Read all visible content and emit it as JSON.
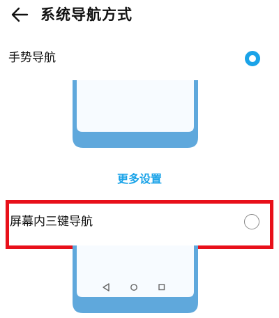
{
  "header": {
    "title": "系统导航方式",
    "back_icon": "arrow-left-icon"
  },
  "options": [
    {
      "label": "手势导航",
      "selected": true
    },
    {
      "label": "屏幕内三键导航",
      "selected": false
    }
  ],
  "more_settings_label": "更多设置",
  "nav_bar_icons": [
    "back-triangle-icon",
    "home-circle-icon",
    "recents-square-icon"
  ],
  "colors": {
    "accent": "#1aa3e8",
    "phone_frame": "#5fa8dc",
    "phone_screen": "#f7fbff",
    "highlight": "#e8101a"
  }
}
